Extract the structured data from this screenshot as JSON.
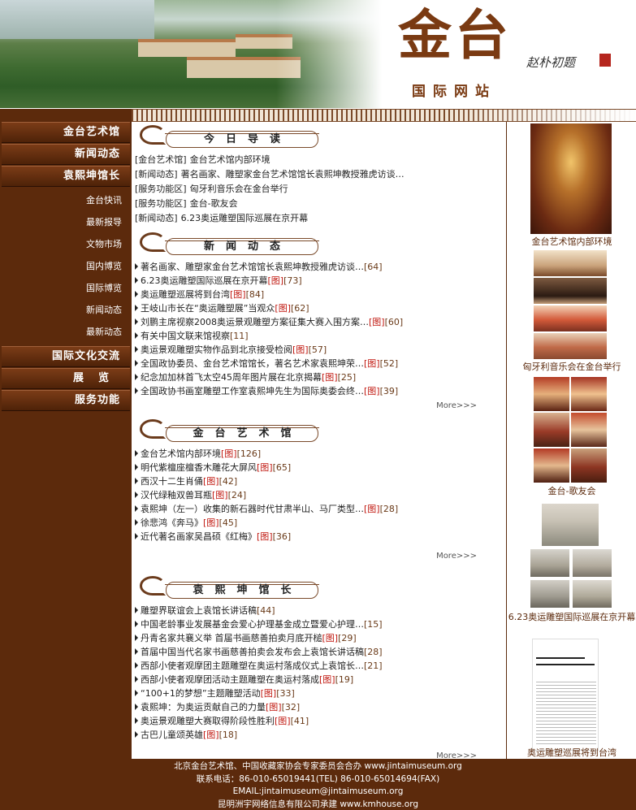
{
  "header": {
    "logo_main": "金台",
    "logo_sub": "国际网站",
    "signature": "赵朴初题"
  },
  "sidebar": {
    "main_items": [
      "金台艺术馆",
      "新闻动态",
      "袁熙坤馆长"
    ],
    "sub_items": [
      "金台快讯",
      "最新报导",
      "文物市场",
      "国内博览",
      "国际博览",
      "新闻动态",
      "最新动态"
    ],
    "bottom_items": [
      "国际文化交流",
      "展览",
      "服务功能"
    ]
  },
  "today": {
    "title": "今日导读",
    "rows": [
      {
        "tag": "[金台艺术馆]",
        "text": "金台艺术馆内部环境"
      },
      {
        "tag": "[新闻动态]",
        "text": "著名画家、雕塑家金台艺术馆馆长袁熙坤教授雅虎访谈…"
      },
      {
        "tag": "[服务功能区]",
        "text": "匈牙利音乐会在金台举行"
      },
      {
        "tag": "[服务功能区]",
        "text": "金台-歌友会"
      },
      {
        "tag": "[新闻动态]",
        "text": "6.23奥运雕塑国际巡展在京开幕"
      }
    ]
  },
  "news": {
    "title": "新闻动态",
    "more": "More>>>",
    "rows": [
      {
        "text": "著名画家、雕塑家金台艺术馆馆长袁熙坤教授雅虎访谈…",
        "pic": "",
        "count": "[64]"
      },
      {
        "text": "6.23奥运雕塑国际巡展在京开幕",
        "pic": "[图]",
        "count": "[73]"
      },
      {
        "text": "奥运雕塑巡展将到台湾",
        "pic": "[图]",
        "count": "[84]"
      },
      {
        "text": "王岐山市长在“奥运雕塑展”当观众",
        "pic": "[图]",
        "count": "[62]"
      },
      {
        "text": "刘鹏主席视察2008奥运景观雕塑方案征集大赛入围方案…",
        "pic": "[图]",
        "count": "[60]"
      },
      {
        "text": "有关中国文联来馆视察",
        "pic": "",
        "count": "[11]"
      },
      {
        "text": "奥运景观雕塑实物作品到北京接受检阅",
        "pic": "[图]",
        "count": "[57]"
      },
      {
        "text": "全国政协委员、金台艺术馆馆长，著名艺术家袁熙坤荣…",
        "pic": "[图]",
        "count": "[52]"
      },
      {
        "text": "纪念加加林首飞太空45周年图片展在北京揭幕",
        "pic": "[图]",
        "count": "[25]"
      },
      {
        "text": "全国政协书画室雕塑工作室袁熙坤先生为国际奥委会终…",
        "pic": "[图]",
        "count": "[39]"
      }
    ]
  },
  "museum": {
    "title": "金台艺术馆",
    "more": "More>>>",
    "rows": [
      {
        "text": "金台艺术馆内部环境",
        "pic": "[图]",
        "count": "[126]"
      },
      {
        "text": "明代紫檀座檀香木雕花大屏风",
        "pic": "[图]",
        "count": "[65]"
      },
      {
        "text": "西汉十二生肖俑",
        "pic": "[图]",
        "count": "[42]"
      },
      {
        "text": "汉代绿釉双兽耳瓶",
        "pic": "[图]",
        "count": "[24]"
      },
      {
        "text": "袁熙坤（左一）收集的新石器时代甘肃半山、马厂类型…",
        "pic": "[图]",
        "count": "[28]"
      },
      {
        "text": "徐悲鸿《奔马》",
        "pic": "[图]",
        "count": "[45]"
      },
      {
        "text": "近代著名画家吴昌硕《红梅》",
        "pic": "[图]",
        "count": "[36]"
      }
    ]
  },
  "director": {
    "title": "袁熙坤馆长",
    "more": "More>>>",
    "rows": [
      {
        "text": "雕塑界联谊会上袁馆长讲话稿",
        "pic": "",
        "count": "[44]"
      },
      {
        "text": "中国老龄事业发展基金会爱心护理基金成立暨爱心护理…",
        "pic": "",
        "count": "[15]"
      },
      {
        "text": "丹青名家共襄义举 首届书画慈善拍卖月底开槌",
        "pic": "[图]",
        "count": "[29]"
      },
      {
        "text": "首届中国当代名家书画慈善拍卖会发布会上袁馆长讲话稿",
        "pic": "",
        "count": "[28]"
      },
      {
        "text": "西部小使者观摩团主题雕塑在奥运村落成仪式上袁馆长…",
        "pic": "",
        "count": "[21]"
      },
      {
        "text": "西部小使者观摩团活动主题雕塑在奥运村落成",
        "pic": "[图]",
        "count": "[19]"
      },
      {
        "text": "“100+1的梦想”主题雕塑活动",
        "pic": "[图]",
        "count": "[33]"
      },
      {
        "text": "袁熙坤：为奥运贡献自己的力量",
        "pic": "[图]",
        "count": "[32]"
      },
      {
        "text": "奥运景观雕塑大赛取得阶段性胜利",
        "pic": "[图]",
        "count": "[41]"
      },
      {
        "text": "古巴儿童颂英雄",
        "pic": "[图]",
        "count": "[18]"
      }
    ]
  },
  "right": {
    "captions": [
      "金台艺术馆内部环境",
      "匈牙利音乐会在金台举行",
      "金台-歌友会",
      "6.23奥运雕塑国际巡展在京开幕",
      "奥运雕塑巡展将到台湾"
    ]
  },
  "footer": {
    "line1": "北京金台艺术馆、中国收藏家协会专家委员会合办 www.jintaimuseum.org",
    "line2": "联系电话：86-010-65019441(TEL) 86-010-65014694(FAX)",
    "line3": "EMAIL:jintaimuseum@jintaimuseum.org",
    "line4": "昆明洲宇网络信息有限公司承建 www.kmhouse.org"
  }
}
